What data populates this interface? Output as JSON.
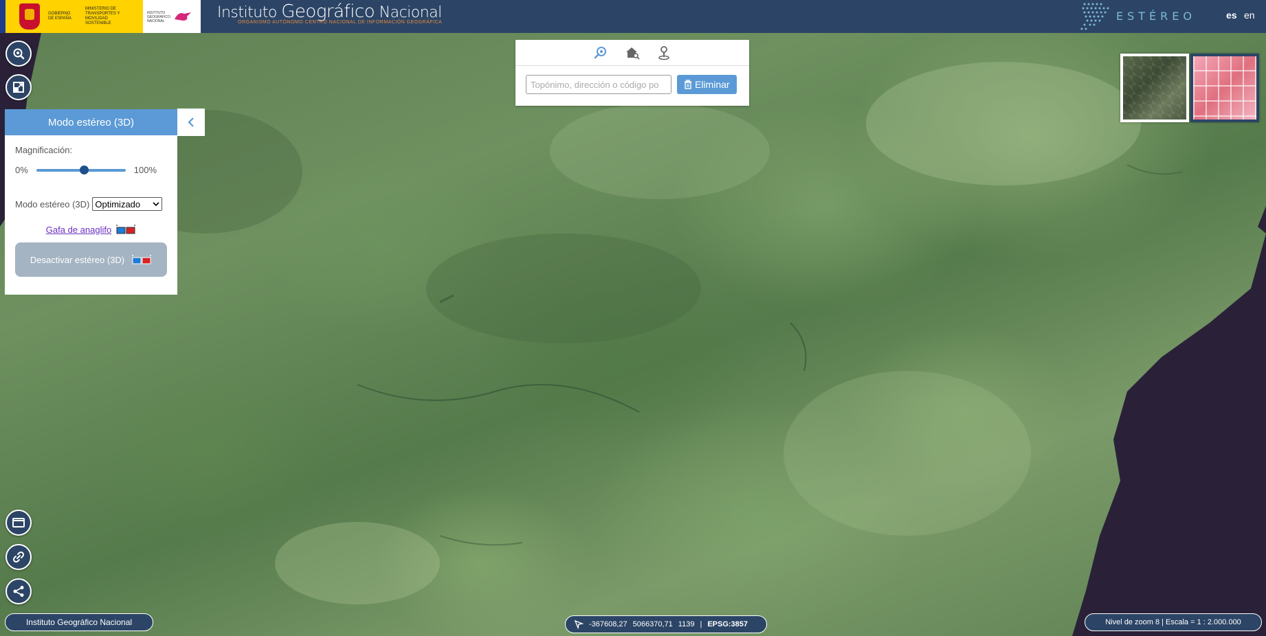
{
  "header": {
    "gov_text_1": "Gobierno de España",
    "gov_text_2": "Ministerio de Transportes y Movilidad Sostenible",
    "ign_mini_text": "Instituto Geográfico Nacional",
    "brand_title_a": "Instituto ",
    "brand_title_b": "Geográfico",
    "brand_title_c": " Nacional",
    "brand_subtitle": "Organismo Autónomo Centro Nacional de Información Geográfica",
    "app_name": "ESTÉREO",
    "lang_es": "es",
    "lang_en": "en"
  },
  "panel": {
    "title": "Modo estéreo (3D)",
    "magnification_label": "Magnificación:",
    "slider_min": "0%",
    "slider_max": "100%",
    "slider_value": 0.54,
    "mode_label": "Modo estéreo (3D)",
    "mode_selected": "Optimizado",
    "anaglyph_link": "Gafa de anaglifo",
    "deactivate_label": "Desactivar estéreo (3D)"
  },
  "search": {
    "placeholder": "Topónimo, dirección o código po",
    "delete_label": "Eliminar"
  },
  "footer": {
    "attribution": "Instituto Geográfico Nacional",
    "coord_x": "-367608,27",
    "coord_y": "5066370,71",
    "coord_z": "1139",
    "crs": "EPSG:3857",
    "zoom_text": "Nivel de zoom 8 | Escala = 1 : 2.000.000"
  },
  "colors": {
    "header_bg": "#2c4566",
    "accent": "#5b9ad6",
    "sea": "#2a2138"
  }
}
